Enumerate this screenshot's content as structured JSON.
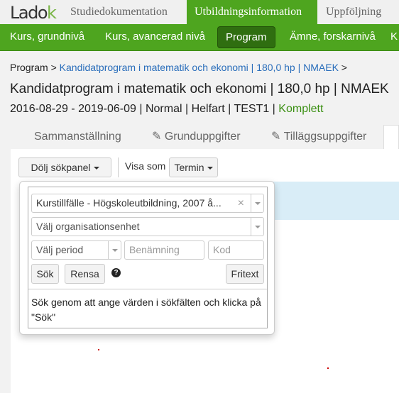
{
  "brand": {
    "logo": "Ladok"
  },
  "top_tabs": [
    {
      "label": "Studiedokumentation"
    },
    {
      "label": "Utbildningsinformation",
      "active": true
    },
    {
      "label": "Uppföljning"
    }
  ],
  "nav": [
    {
      "label": "Kurs, grundnivå"
    },
    {
      "label": "Kurs, avancerad nivå"
    },
    {
      "label": "Program",
      "active": true
    },
    {
      "label": "Ämne, forskarnivå"
    },
    {
      "label": "K"
    }
  ],
  "breadcrumb": {
    "root": "Program",
    "sep": ">",
    "current": "Kandidatprogram i matematik och ekonomi | 180,0 hp | NMAEK"
  },
  "page": {
    "title": "Kandidatprogram i matematik och ekonomi | 180,0 hp | NMAEK",
    "subtitle": "2016-08-29 - 2019-06-09 | Normal | Helfart | TEST1 |",
    "status": "Komplett",
    "status_color": "#3a8f12"
  },
  "tabs": [
    {
      "label": "Sammanställning"
    },
    {
      "label": "Grunduppgifter",
      "icon": "pencil-icon"
    },
    {
      "label": "Tilläggsuppgifter",
      "icon": "pencil-icon"
    }
  ],
  "toolbar": {
    "toggle_label": "Dölj sökpanel",
    "view_label": "Visa som",
    "view_value": "Termin"
  },
  "search": {
    "type_value": "Kurstillfälle - Högskoleutbildning, 2007 å...",
    "clear": "×",
    "org_placeholder": "Välj organisationsenhet",
    "period_placeholder": "Välj period",
    "name_placeholder": "Benämning",
    "code_placeholder": "Kod",
    "search_btn": "Sök",
    "clear_btn": "Rensa",
    "help": "?",
    "freetext_btn": "Fritext",
    "hint": "Sök genom att ange värden i sökfälten och klicka på \"Sök\""
  },
  "colors": {
    "brand_green": "#4ea51f",
    "active_nav": "#2f6e10",
    "link": "#2a6ebb"
  }
}
